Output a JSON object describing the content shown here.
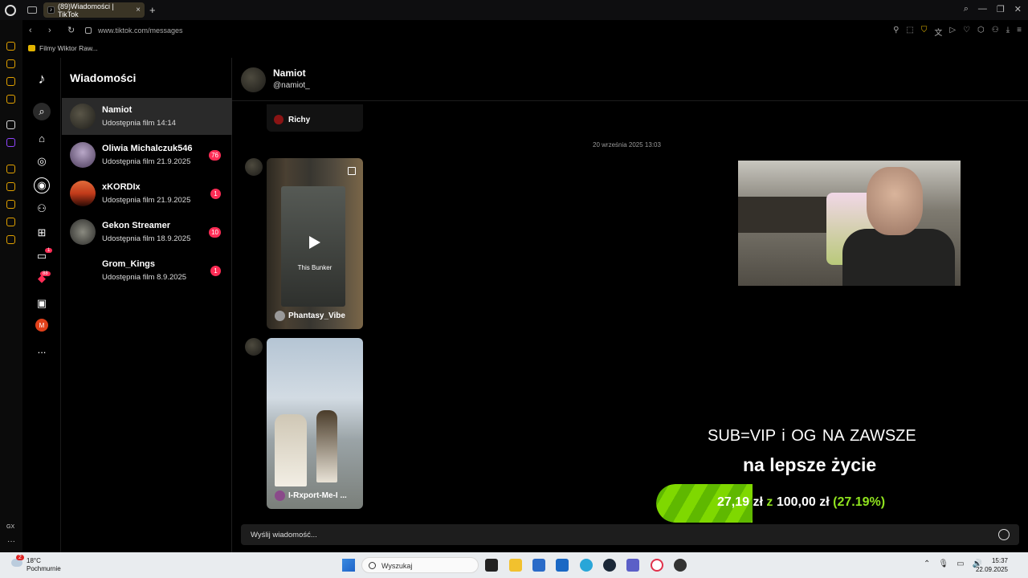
{
  "browser": {
    "tab_title": "(89)Wiadomości | TikTok",
    "tab_favicon": "tiktok-icon",
    "url": "www.tiktok.com/messages",
    "bookmark": "Filmy Wiktor Raw..."
  },
  "tiktok_rail": {
    "notifications_badge": "1",
    "inbox_badge": "88",
    "profile_initial": "M",
    "more_label": "..."
  },
  "conversations": {
    "heading": "Wiadomości",
    "items": [
      {
        "name": "Namiot",
        "sub": "Udostępnia film 14:14",
        "badge": ""
      },
      {
        "name": "Oliwia Michalczuk546",
        "sub": "Udostępnia film 21.9.2025",
        "badge": "76"
      },
      {
        "name": "xKORDIx",
        "sub": "Udostępnia film 21.9.2025",
        "badge": "1"
      },
      {
        "name": "Gekon Streamer",
        "sub": "Udostępnia film 18.9.2025",
        "badge": "10"
      },
      {
        "name": "Grom_Kings",
        "sub": "Udostępnia film 8.9.2025",
        "badge": "1"
      }
    ]
  },
  "chat": {
    "name": "Namiot",
    "username": "@namiot_",
    "prev_author": "Richy",
    "timestamp": "20 września 2025 13:03",
    "videos": [
      {
        "caption": "This Bunker",
        "author": "Phantasy_Vibe"
      },
      {
        "caption": "",
        "author": "I-Rxport-Me-I ..."
      }
    ],
    "composer_placeholder": "Wyślij wiadomość..."
  },
  "stream_overlay": {
    "line1": "SUB=VIP i OG   NA ZAWSZE",
    "line2": "na lepsze życie",
    "goal_current": "27,19 zł",
    "goal_sep": "z",
    "goal_target": "100,00 zł",
    "goal_percent_label": "(27.19%)",
    "goal_fraction": 0.2719
  },
  "taskbar": {
    "weather_temp": "18°C",
    "weather_desc": "Pochmurnie",
    "weather_badge": "2",
    "search_placeholder": "Wyszukaj",
    "time": "15:37",
    "date": "22.09.2025"
  }
}
